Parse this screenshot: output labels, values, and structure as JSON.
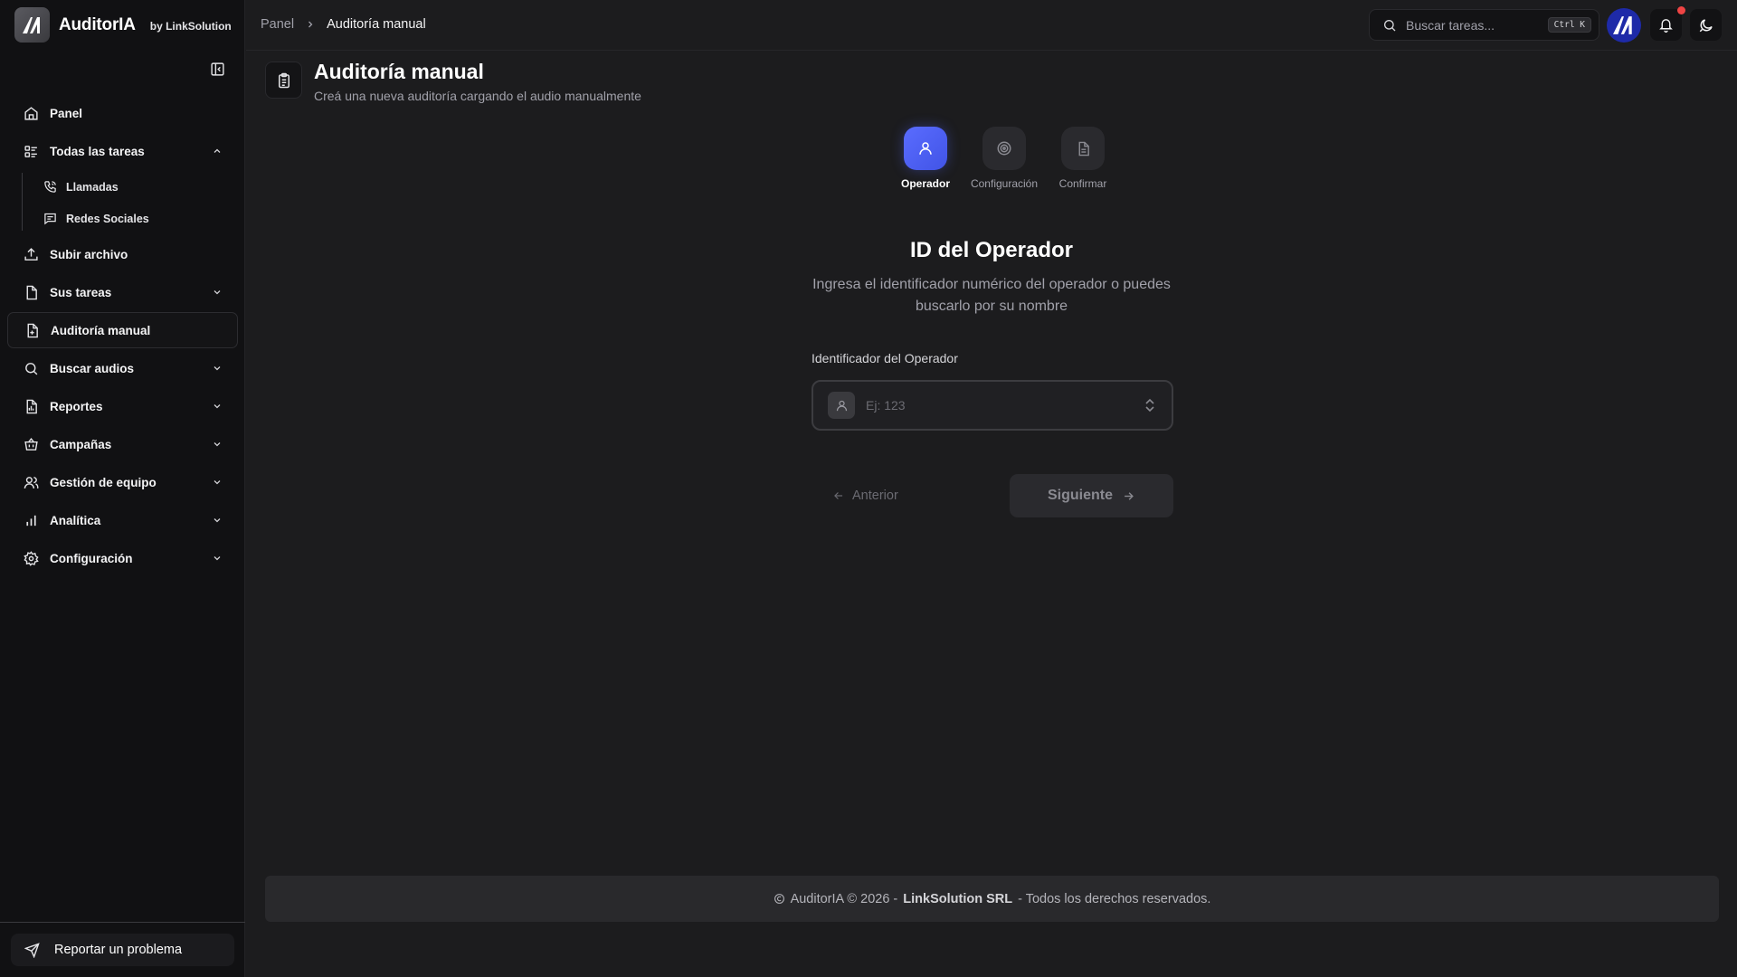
{
  "brand": {
    "name": "AuditorIA",
    "by": "by LinkSolution"
  },
  "sidebar": {
    "items": [
      {
        "label": "Panel",
        "icon": "home-icon"
      },
      {
        "label": "Todas las tareas",
        "icon": "tasks-icon",
        "expanded": true,
        "children": [
          {
            "label": "Llamadas",
            "icon": "phone-icon"
          },
          {
            "label": "Redes Sociales",
            "icon": "message-icon"
          }
        ]
      },
      {
        "label": "Subir archivo",
        "icon": "upload-icon"
      },
      {
        "label": "Sus tareas",
        "icon": "file-icon"
      },
      {
        "label": "Auditoría manual",
        "icon": "file-plus-icon",
        "active": true
      },
      {
        "label": "Buscar audios",
        "icon": "search-icon"
      },
      {
        "label": "Reportes",
        "icon": "report-icon"
      },
      {
        "label": "Campañas",
        "icon": "campaign-icon"
      },
      {
        "label": "Gestión de equipo",
        "icon": "users-icon"
      },
      {
        "label": "Analítica",
        "icon": "chart-icon"
      },
      {
        "label": "Configuración",
        "icon": "gear-icon"
      }
    ],
    "report_button": "Reportar un problema"
  },
  "topbar": {
    "breadcrumb": {
      "root": "Panel",
      "current": "Auditoría manual"
    },
    "search": {
      "placeholder": "Buscar tareas...",
      "shortcut": "Ctrl K"
    }
  },
  "page": {
    "title": "Auditoría manual",
    "subtitle": "Creá una nueva auditoría cargando el audio manualmente"
  },
  "stepper": {
    "steps": [
      {
        "label": "Operador",
        "icon": "user-icon",
        "active": true
      },
      {
        "label": "Configuración",
        "icon": "target-icon",
        "active": false
      },
      {
        "label": "Confirmar",
        "icon": "document-icon",
        "active": false
      }
    ]
  },
  "form": {
    "title": "ID del Operador",
    "description": "Ingresa el identificador numérico del operador o puedes buscarlo por su nombre",
    "field_label": "Identificador del Operador",
    "field_placeholder": "Ej: 123",
    "field_value": "",
    "prev_label": "Anterior",
    "next_label": "Siguiente"
  },
  "footer": {
    "prefix": "AuditorIA © 2026 -",
    "company": "LinkSolution SRL",
    "suffix": "- Todos los derechos reservados."
  },
  "colors": {
    "accent": "#4f5ff5",
    "background": "#1c1c1e",
    "sidebar": "#111113",
    "notification": "#ef4444"
  }
}
